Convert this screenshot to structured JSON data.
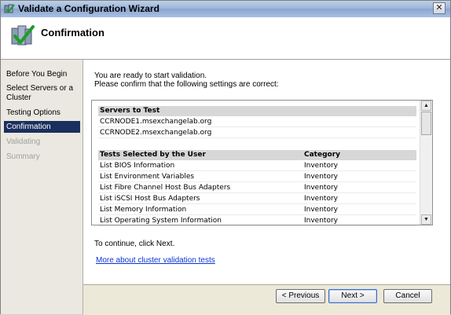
{
  "window": {
    "title": "Validate a Configuration Wizard"
  },
  "header": {
    "heading": "Confirmation"
  },
  "nav": {
    "items": [
      {
        "label": "Before You Begin",
        "state": "normal"
      },
      {
        "label": "Select Servers or a Cluster",
        "state": "normal"
      },
      {
        "label": "Testing Options",
        "state": "normal"
      },
      {
        "label": "Confirmation",
        "state": "active"
      },
      {
        "label": "Validating",
        "state": "disabled"
      },
      {
        "label": "Summary",
        "state": "disabled"
      }
    ]
  },
  "main": {
    "intro_line1": "You are ready to start validation.",
    "intro_line2": "Please confirm that the following settings are correct:",
    "servers_header": "Servers to Test",
    "servers": [
      "CCRNODE1.msexchangelab.org",
      "CCRNODE2.msexchangelab.org"
    ],
    "tests_header": "Tests Selected by the User",
    "category_header": "Category",
    "tests": [
      {
        "name": "List BIOS Information",
        "category": "Inventory"
      },
      {
        "name": "List Environment Variables",
        "category": "Inventory"
      },
      {
        "name": "List Fibre Channel Host Bus Adapters",
        "category": "Inventory"
      },
      {
        "name": "List iSCSI Host Bus Adapters",
        "category": "Inventory"
      },
      {
        "name": "List Memory Information",
        "category": "Inventory"
      },
      {
        "name": "List Operating System Information",
        "category": "Inventory"
      }
    ],
    "continue_text": "To continue, click Next.",
    "more_link": "More about cluster validation tests"
  },
  "footer": {
    "previous": "< Previous",
    "next": "Next >",
    "cancel": "Cancel"
  },
  "icons": {
    "app": "cluster-wizard-icon",
    "header": "validate-checkmark-icon",
    "close": "close-icon",
    "scroll_up": "scroll-up-arrow-icon",
    "scroll_down": "scroll-down-arrow-icon"
  },
  "colors": {
    "nav_active_bg": "#1a2f5e",
    "link": "#0a34d6"
  }
}
